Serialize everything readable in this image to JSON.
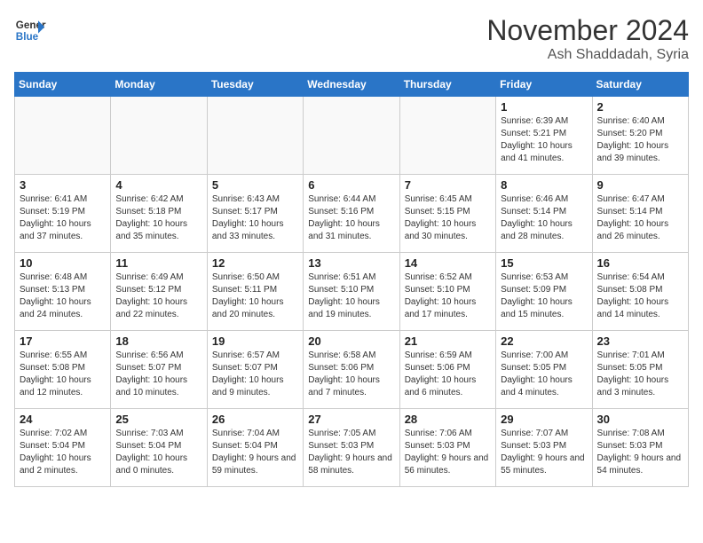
{
  "logo": {
    "line1": "General",
    "line2": "Blue"
  },
  "title": "November 2024",
  "location": "Ash Shaddadah, Syria",
  "headers": [
    "Sunday",
    "Monday",
    "Tuesday",
    "Wednesday",
    "Thursday",
    "Friday",
    "Saturday"
  ],
  "weeks": [
    [
      {
        "day": "",
        "content": ""
      },
      {
        "day": "",
        "content": ""
      },
      {
        "day": "",
        "content": ""
      },
      {
        "day": "",
        "content": ""
      },
      {
        "day": "",
        "content": ""
      },
      {
        "day": "1",
        "content": "Sunrise: 6:39 AM\nSunset: 5:21 PM\nDaylight: 10 hours and 41 minutes."
      },
      {
        "day": "2",
        "content": "Sunrise: 6:40 AM\nSunset: 5:20 PM\nDaylight: 10 hours and 39 minutes."
      }
    ],
    [
      {
        "day": "3",
        "content": "Sunrise: 6:41 AM\nSunset: 5:19 PM\nDaylight: 10 hours and 37 minutes."
      },
      {
        "day": "4",
        "content": "Sunrise: 6:42 AM\nSunset: 5:18 PM\nDaylight: 10 hours and 35 minutes."
      },
      {
        "day": "5",
        "content": "Sunrise: 6:43 AM\nSunset: 5:17 PM\nDaylight: 10 hours and 33 minutes."
      },
      {
        "day": "6",
        "content": "Sunrise: 6:44 AM\nSunset: 5:16 PM\nDaylight: 10 hours and 31 minutes."
      },
      {
        "day": "7",
        "content": "Sunrise: 6:45 AM\nSunset: 5:15 PM\nDaylight: 10 hours and 30 minutes."
      },
      {
        "day": "8",
        "content": "Sunrise: 6:46 AM\nSunset: 5:14 PM\nDaylight: 10 hours and 28 minutes."
      },
      {
        "day": "9",
        "content": "Sunrise: 6:47 AM\nSunset: 5:14 PM\nDaylight: 10 hours and 26 minutes."
      }
    ],
    [
      {
        "day": "10",
        "content": "Sunrise: 6:48 AM\nSunset: 5:13 PM\nDaylight: 10 hours and 24 minutes."
      },
      {
        "day": "11",
        "content": "Sunrise: 6:49 AM\nSunset: 5:12 PM\nDaylight: 10 hours and 22 minutes."
      },
      {
        "day": "12",
        "content": "Sunrise: 6:50 AM\nSunset: 5:11 PM\nDaylight: 10 hours and 20 minutes."
      },
      {
        "day": "13",
        "content": "Sunrise: 6:51 AM\nSunset: 5:10 PM\nDaylight: 10 hours and 19 minutes."
      },
      {
        "day": "14",
        "content": "Sunrise: 6:52 AM\nSunset: 5:10 PM\nDaylight: 10 hours and 17 minutes."
      },
      {
        "day": "15",
        "content": "Sunrise: 6:53 AM\nSunset: 5:09 PM\nDaylight: 10 hours and 15 minutes."
      },
      {
        "day": "16",
        "content": "Sunrise: 6:54 AM\nSunset: 5:08 PM\nDaylight: 10 hours and 14 minutes."
      }
    ],
    [
      {
        "day": "17",
        "content": "Sunrise: 6:55 AM\nSunset: 5:08 PM\nDaylight: 10 hours and 12 minutes."
      },
      {
        "day": "18",
        "content": "Sunrise: 6:56 AM\nSunset: 5:07 PM\nDaylight: 10 hours and 10 minutes."
      },
      {
        "day": "19",
        "content": "Sunrise: 6:57 AM\nSunset: 5:07 PM\nDaylight: 10 hours and 9 minutes."
      },
      {
        "day": "20",
        "content": "Sunrise: 6:58 AM\nSunset: 5:06 PM\nDaylight: 10 hours and 7 minutes."
      },
      {
        "day": "21",
        "content": "Sunrise: 6:59 AM\nSunset: 5:06 PM\nDaylight: 10 hours and 6 minutes."
      },
      {
        "day": "22",
        "content": "Sunrise: 7:00 AM\nSunset: 5:05 PM\nDaylight: 10 hours and 4 minutes."
      },
      {
        "day": "23",
        "content": "Sunrise: 7:01 AM\nSunset: 5:05 PM\nDaylight: 10 hours and 3 minutes."
      }
    ],
    [
      {
        "day": "24",
        "content": "Sunrise: 7:02 AM\nSunset: 5:04 PM\nDaylight: 10 hours and 2 minutes."
      },
      {
        "day": "25",
        "content": "Sunrise: 7:03 AM\nSunset: 5:04 PM\nDaylight: 10 hours and 0 minutes."
      },
      {
        "day": "26",
        "content": "Sunrise: 7:04 AM\nSunset: 5:04 PM\nDaylight: 9 hours and 59 minutes."
      },
      {
        "day": "27",
        "content": "Sunrise: 7:05 AM\nSunset: 5:03 PM\nDaylight: 9 hours and 58 minutes."
      },
      {
        "day": "28",
        "content": "Sunrise: 7:06 AM\nSunset: 5:03 PM\nDaylight: 9 hours and 56 minutes."
      },
      {
        "day": "29",
        "content": "Sunrise: 7:07 AM\nSunset: 5:03 PM\nDaylight: 9 hours and 55 minutes."
      },
      {
        "day": "30",
        "content": "Sunrise: 7:08 AM\nSunset: 5:03 PM\nDaylight: 9 hours and 54 minutes."
      }
    ]
  ]
}
